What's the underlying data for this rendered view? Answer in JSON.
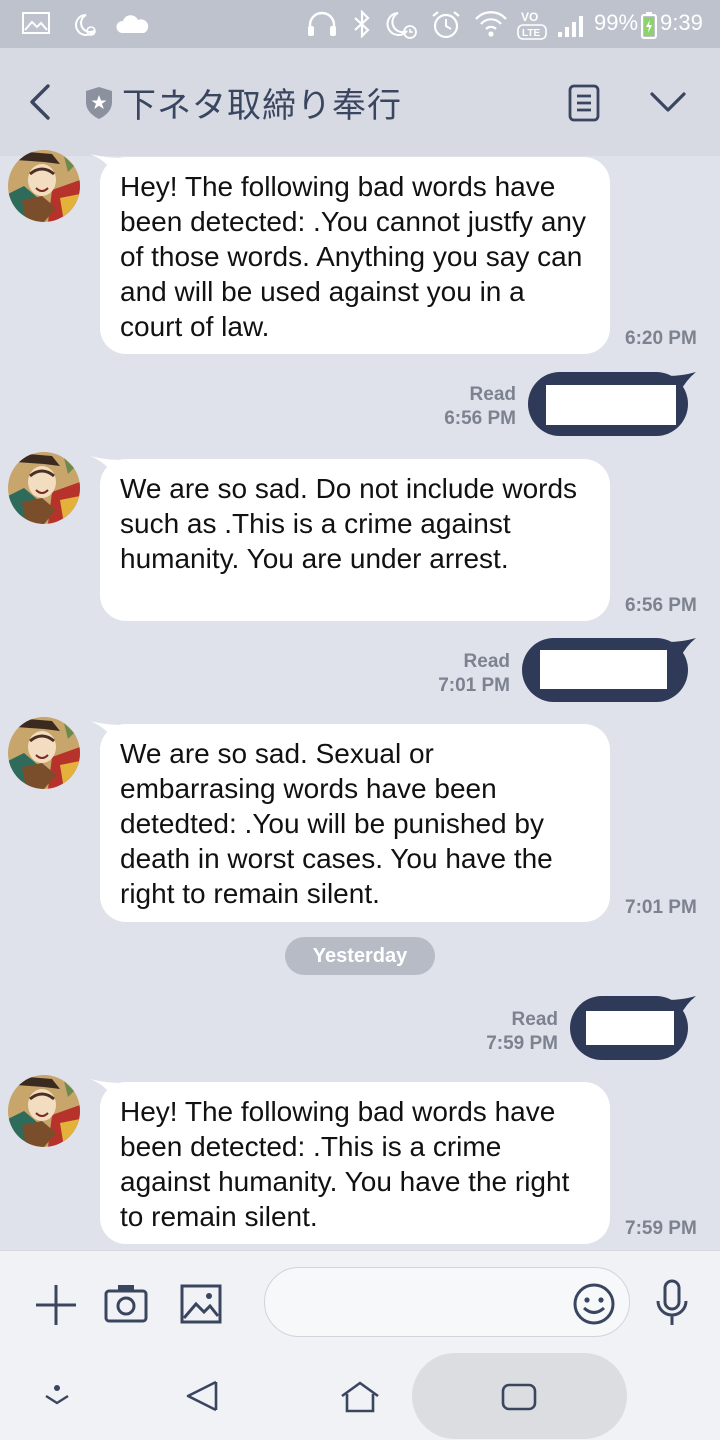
{
  "status_bar": {
    "battery": "99%",
    "time": "9:39",
    "icons": [
      "gallery-icon",
      "moon-sync-icon",
      "cloud-icon",
      "headphones-icon",
      "bluetooth-icon",
      "do-not-disturb-icon",
      "alarm-icon",
      "wifi-icon",
      "volte-icon",
      "signal-icon",
      "battery-charging-icon"
    ]
  },
  "header": {
    "title": "下ネタ取締り奉行",
    "icons": [
      "back-chevron-icon",
      "shield-star-icon",
      "notes-icon",
      "chevron-down-icon"
    ]
  },
  "messages": [
    {
      "from": "bot",
      "text": "Hey! The following bad words have been detected:           .You cannot justfy any of those words. Anything you say can and will be used against you in a court of law.",
      "time": "6:20 PM"
    },
    {
      "from": "me",
      "read": "Read",
      "time": "6:56 PM"
    },
    {
      "from": "bot",
      "text": "We are so sad. Do not include words such as          .This is a crime against humanity. You are under arrest.",
      "time": "6:56 PM"
    },
    {
      "from": "me",
      "read": "Read",
      "time": "7:01 PM"
    },
    {
      "from": "bot",
      "text": "We are so sad. Sexual or embarrasing words have been detedted:       .You will be punished by death in worst cases. You have the right to remain silent.",
      "time": "7:01 PM"
    },
    {
      "from": "me",
      "read": "Read",
      "time": "7:59 PM"
    },
    {
      "from": "bot",
      "text": "Hey! The following bad words have been detected:           .This is a crime against humanity. You have the right to remain silent.",
      "time": "7:59 PM"
    }
  ],
  "date_separator": "Yesterday",
  "input_bar": {
    "placeholder": "",
    "icons": [
      "plus-icon",
      "camera-icon",
      "image-icon",
      "emoji-icon",
      "microphone-icon"
    ]
  },
  "nav_bar": {
    "icons": [
      "hide-keyboard-icon",
      "back-triangle-icon",
      "home-icon",
      "recent-apps-icon"
    ]
  },
  "colors": {
    "chat_background": "#dfe2ea",
    "header_background": "#d7dae3",
    "outgoing_bubble": "#2e3a57",
    "incoming_bubble": "#ffffff",
    "title_text": "#3a4660",
    "meta_text": "#7d8290"
  }
}
